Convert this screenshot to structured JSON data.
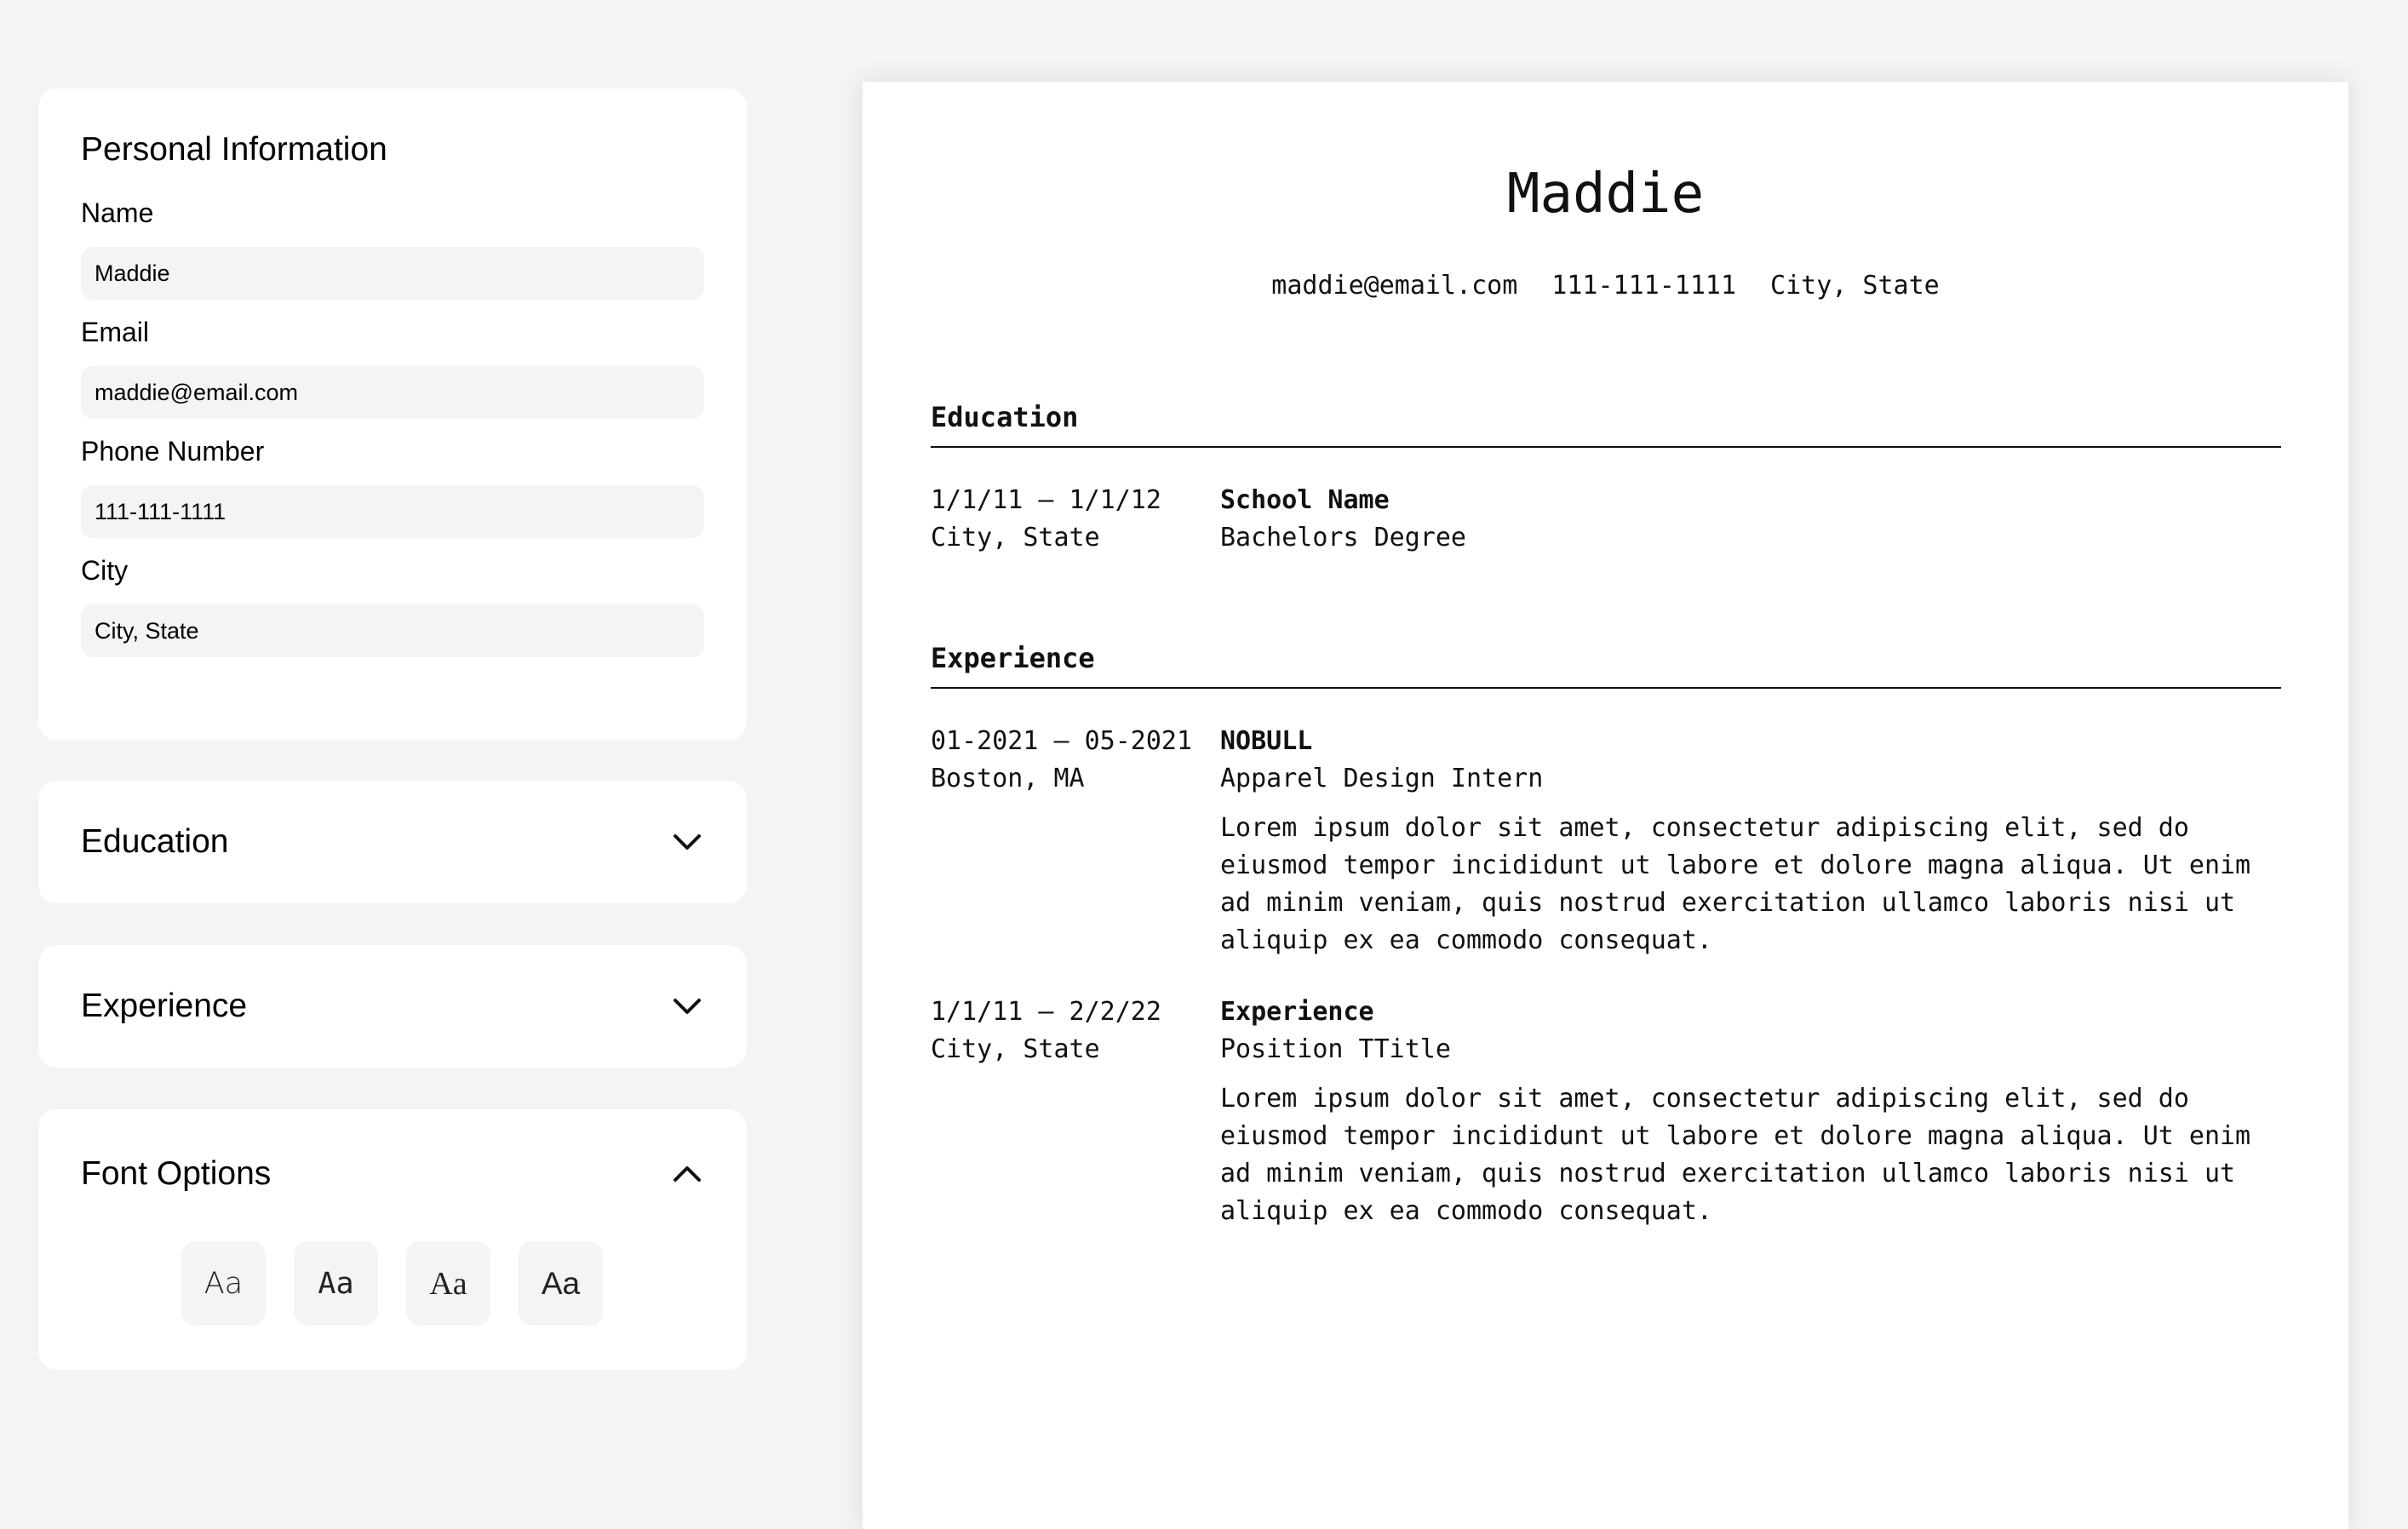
{
  "personal": {
    "title": "Personal Information",
    "fields": [
      {
        "label": "Name",
        "value": "Maddie"
      },
      {
        "label": "Email",
        "value": "maddie@email.com"
      },
      {
        "label": "Phone Number",
        "value": "111-111-1111"
      },
      {
        "label": "City",
        "value": "City, State"
      }
    ]
  },
  "sections": {
    "education_label": "Education",
    "experience_label": "Experience",
    "font_options_label": "Font Options"
  },
  "font_buttons": [
    "Aa",
    "Aa",
    "Aa",
    "Aa"
  ],
  "icons": {
    "education_toggle": "chevron-down-icon",
    "experience_toggle": "chevron-down-icon",
    "font_toggle": "chevron-up-icon"
  },
  "resume": {
    "name": "Maddie",
    "email": "maddie@email.com",
    "phone": "111-111-1111",
    "location": "City, State",
    "education_heading": "Education",
    "education": [
      {
        "dates": "1/1/11 – 1/1/12",
        "location": "City, State",
        "school": "School Name",
        "degree": "Bachelors Degree"
      }
    ],
    "experience_heading": "Experience",
    "experience": [
      {
        "dates": "01-2021 – 05-2021",
        "location": "Boston, MA",
        "company": "NOBULL",
        "position": "Apparel Design Intern",
        "description": "Lorem ipsum dolor sit amet, consectetur adipiscing elit, sed do eiusmod tempor incididunt ut labore et dolore magna aliqua. Ut enim ad minim veniam, quis nostrud exercitation ullamco laboris nisi ut aliquip ex ea commodo consequat."
      },
      {
        "dates": "1/1/11 – 2/2/22",
        "location": "City, State",
        "company": "Experience",
        "position": "Position TTitle",
        "description": "Lorem ipsum dolor sit amet, consectetur adipiscing elit, sed do eiusmod tempor incididunt ut labore et dolore magna aliqua. Ut enim ad minim veniam, quis nostrud exercitation ullamco laboris nisi ut aliquip ex ea commodo consequat."
      }
    ]
  }
}
